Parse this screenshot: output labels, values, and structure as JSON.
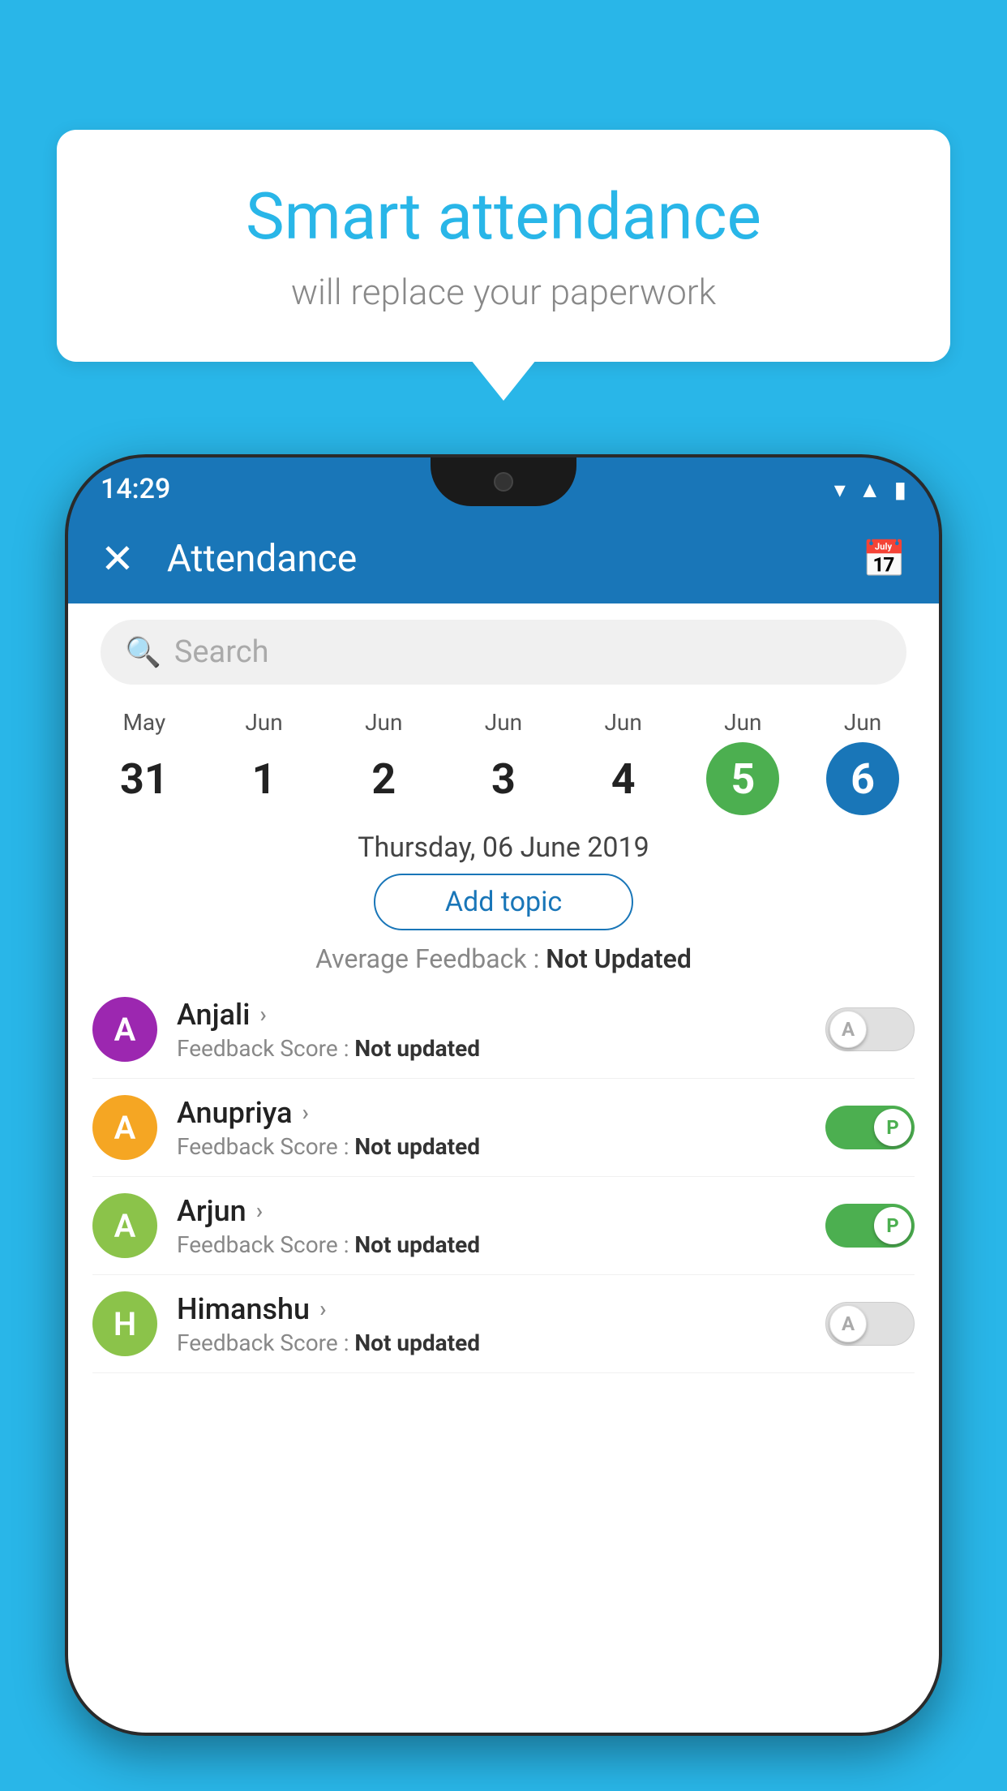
{
  "background_color": "#29b6e8",
  "speech_bubble": {
    "title": "Smart attendance",
    "subtitle": "will replace your paperwork"
  },
  "status_bar": {
    "time": "14:29",
    "wifi_icon": "▾",
    "signal_icon": "▲",
    "battery_icon": "▮"
  },
  "app_bar": {
    "title": "Attendance",
    "close_label": "✕",
    "calendar_icon": "📅"
  },
  "search": {
    "placeholder": "Search"
  },
  "calendar": {
    "days": [
      {
        "month": "May",
        "date": "31",
        "style": "normal"
      },
      {
        "month": "Jun",
        "date": "1",
        "style": "normal"
      },
      {
        "month": "Jun",
        "date": "2",
        "style": "normal"
      },
      {
        "month": "Jun",
        "date": "3",
        "style": "normal"
      },
      {
        "month": "Jun",
        "date": "4",
        "style": "normal"
      },
      {
        "month": "Jun",
        "date": "5",
        "style": "green"
      },
      {
        "month": "Jun",
        "date": "6",
        "style": "blue"
      }
    ],
    "selected_date": "Thursday, 06 June 2019"
  },
  "add_topic_label": "Add topic",
  "average_feedback": {
    "label": "Average Feedback : ",
    "value": "Not Updated"
  },
  "students": [
    {
      "name": "Anjali",
      "avatar_letter": "A",
      "avatar_color": "#9c27b0",
      "feedback_label": "Feedback Score : ",
      "feedback_value": "Not updated",
      "toggle": "off",
      "toggle_letter": "A"
    },
    {
      "name": "Anupriya",
      "avatar_letter": "A",
      "avatar_color": "#f5a623",
      "feedback_label": "Feedback Score : ",
      "feedback_value": "Not updated",
      "toggle": "on",
      "toggle_letter": "P"
    },
    {
      "name": "Arjun",
      "avatar_letter": "A",
      "avatar_color": "#8bc34a",
      "feedback_label": "Feedback Score : ",
      "feedback_value": "Not updated",
      "toggle": "on",
      "toggle_letter": "P"
    },
    {
      "name": "Himanshu",
      "avatar_letter": "H",
      "avatar_color": "#8bc34a",
      "feedback_label": "Feedback Score : ",
      "feedback_value": "Not updated",
      "toggle": "off",
      "toggle_letter": "A"
    }
  ]
}
